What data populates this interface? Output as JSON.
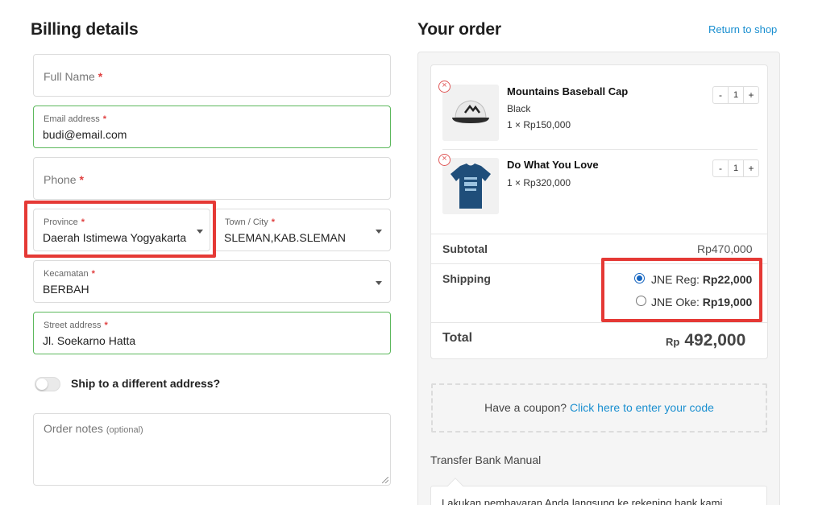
{
  "billing": {
    "title": "Billing details",
    "full_name": {
      "placeholder": "Full Name",
      "required": "*"
    },
    "email": {
      "label": "Email address",
      "required": "*",
      "value": "budi@email.com"
    },
    "phone": {
      "placeholder": "Phone",
      "required": "*"
    },
    "province": {
      "label": "Province",
      "required": "*",
      "value": "Daerah Istimewa Yogyakarta"
    },
    "town": {
      "label": "Town / City",
      "required": "*",
      "value": "SLEMAN,KAB.SLEMAN"
    },
    "kecamatan": {
      "label": "Kecamatan",
      "required": "*",
      "value": "BERBAH"
    },
    "street": {
      "label": "Street address",
      "required": "*",
      "value": "Jl. Soekarno Hatta"
    },
    "ship_different": "Ship to a different address?",
    "order_notes": {
      "placeholder": "Order notes",
      "optional": "(optional)"
    }
  },
  "order": {
    "title": "Your order",
    "return_link": "Return to shop",
    "items": [
      {
        "name": "Mountains Baseball Cap",
        "variant": "Black",
        "price": "1 × Rp150,000",
        "qty_minus": "-",
        "qty": "1",
        "qty_plus": "+",
        "remove": "×"
      },
      {
        "name": "Do What You Love",
        "price": "1 × Rp320,000",
        "qty_minus": "-",
        "qty": "1",
        "qty_plus": "+",
        "remove": "×"
      }
    ],
    "subtotal_label": "Subtotal",
    "subtotal_value": "Rp470,000",
    "shipping_label": "Shipping",
    "shipping_options": [
      {
        "name": "JNE Reg: ",
        "price": "Rp22,000",
        "selected": true
      },
      {
        "name": "JNE Oke: ",
        "price": "Rp19,000",
        "selected": false
      }
    ],
    "total_label": "Total",
    "total_currency": "Rp",
    "total_value": "492,000",
    "coupon_text": "Have a coupon? ",
    "coupon_link": "Click here to enter your code",
    "payment_method": "Transfer Bank Manual",
    "payment_desc": "Lakukan pembayaran Anda langsung ke rekening bank kami."
  },
  "colors": {
    "accent_link": "#1a8fd0",
    "active_border": "#5cb85c",
    "highlight_box": "#e53935",
    "required": "#e04040"
  }
}
